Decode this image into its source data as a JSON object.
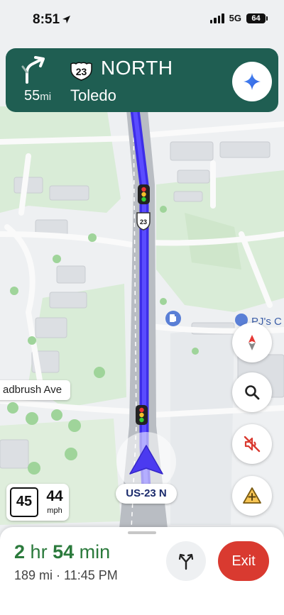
{
  "status_bar": {
    "time": "8:51",
    "network": "5G",
    "battery": "64"
  },
  "banner": {
    "distance": "55",
    "distance_unit": "mi",
    "route_number": "23",
    "direction": "NORTH",
    "city": "Toledo",
    "turn_icon": "turn-slight-right-icon",
    "assistant_icon": "gemini-sparkle-icon",
    "color": "#1f5e52"
  },
  "map": {
    "street_label": "adbrush Ave",
    "route_label": "US-23 N",
    "shield_number": "23",
    "poi_label": "PJ's C",
    "route_color": "#3d2ee8"
  },
  "controls": {
    "compass": "compass-icon",
    "search": "search-icon",
    "mute": "volume-off-icon",
    "report": "report-incident-icon"
  },
  "speed": {
    "limit": "45",
    "current": "44",
    "unit": "mph"
  },
  "trip": {
    "hours": "2",
    "hr_label": "hr",
    "minutes": "54",
    "min_label": "min",
    "details": "189 mi · 11:45 PM",
    "exit_label": "Exit",
    "exit_color": "#d93a30",
    "eta_color": "#2b7a3c"
  }
}
